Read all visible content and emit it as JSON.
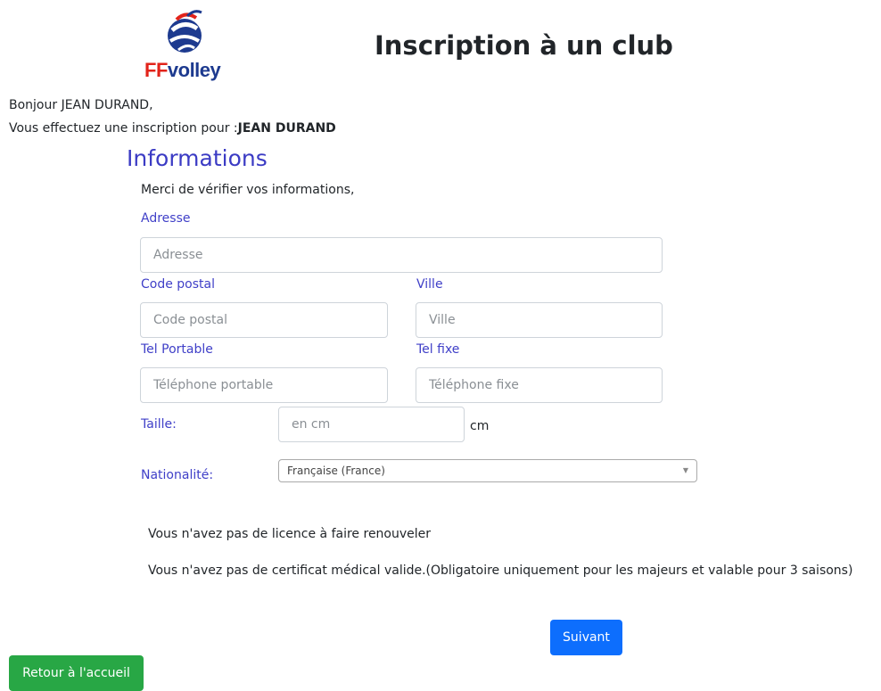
{
  "brand": {
    "logo_ff": "FF",
    "logo_volley": "volley"
  },
  "header": {
    "title": "Inscription à un club"
  },
  "greeting": "Bonjour JEAN DURAND,",
  "notice": {
    "prefix": "Vous effectuez une inscription pour :",
    "name": "JEAN DURAND"
  },
  "section": {
    "title": "Informations",
    "verify_message": "Merci de vérifier vos informations,"
  },
  "form": {
    "adresse": {
      "label": "Adresse",
      "placeholder": "Adresse",
      "value": ""
    },
    "code_postal": {
      "label": "Code postal",
      "placeholder": "Code postal",
      "value": ""
    },
    "ville": {
      "label": "Ville",
      "placeholder": "Ville",
      "value": ""
    },
    "tel_portable": {
      "label": "Tel Portable",
      "placeholder": "Téléphone portable",
      "value": ""
    },
    "tel_fixe": {
      "label": "Tel fixe",
      "placeholder": "Téléphone fixe",
      "value": ""
    },
    "taille": {
      "label": "Taille:",
      "placeholder": "en cm",
      "unit": "cm",
      "value": ""
    },
    "nationalite": {
      "label": "Nationalité:",
      "selected": "Française (France)"
    }
  },
  "messages": {
    "licence": "Vous n'avez pas de licence à faire renouveler",
    "certificat": "Vous n'avez pas de certificat médical valide.(Obligatoire uniquement pour les majeurs et valable pour 3 saisons)"
  },
  "buttons": {
    "next": "Suivant",
    "home": "Retour à l'accueil"
  },
  "colors": {
    "label_blue": "#4040c8",
    "next_button": "#0d6efd",
    "home_button": "#28a745",
    "logo_red": "#e2231a",
    "logo_blue": "#1d3a8f"
  },
  "icons": {
    "logo": "ffvolley-logo",
    "select_arrow": "chevron-down-icon"
  }
}
